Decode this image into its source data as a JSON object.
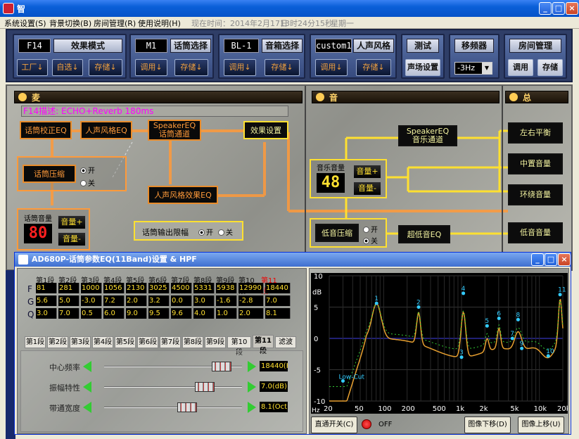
{
  "window": {
    "title": "智"
  },
  "menu": {
    "items": [
      "系统设置(S)",
      "背景切换(B)",
      "房间管理(R)",
      "使用说明(H)"
    ],
    "clock_label": "现在时间：2014年2月17日",
    "clock_time": "13时24分15秒",
    "weekday": "星期一"
  },
  "toolbar": {
    "effect": {
      "lcd": "F14",
      "title": "效果模式",
      "btn1": "工厂↓",
      "btn2": "自选↓",
      "btn3": "存储↓"
    },
    "mic": {
      "lcd": "M1",
      "title": "话筒选择",
      "btn1": "调用↓",
      "btn2": "存储↓"
    },
    "speaker": {
      "lcd": "BL-1",
      "title": "音箱选择",
      "btn1": "调用↓",
      "btn2": "存储↓"
    },
    "voice": {
      "lcd": "custom1",
      "title": "人声风格",
      "btn1": "调用↓",
      "btn2": "存储↓"
    },
    "test": {
      "title": "测试",
      "btn1": "声场设置"
    },
    "shift": {
      "title": "移频器",
      "value": "-3Hz"
    },
    "room": {
      "title": "房间管理",
      "btn1": "调用",
      "btn2": "存储"
    }
  },
  "main": {
    "sections": {
      "mic": "麦",
      "music": "音",
      "total": "总"
    },
    "description": "F14描述: ECHO+Reverb 180ms",
    "mic_blocks": {
      "mic_eq": "话筒校正EQ",
      "voice_eq": "人声风格EQ",
      "speaker_eq_line1": "SpeakerEQ",
      "speaker_eq_line2": "话筒通道",
      "effect_set": "效果设置",
      "compress": "话筒压缩",
      "voice_effect_eq": "人声风格效果EQ"
    },
    "compress_on": "开",
    "compress_off": "关",
    "mic_volume_label": "话筒音量",
    "mic_volume": "80",
    "mic_vol_up": "音量+",
    "mic_vol_down": "音量-",
    "mic_limit_label": "话筒输出限幅",
    "mic_limit_on": "开",
    "mic_limit_off": "关",
    "music_volume_label": "音乐音量",
    "music_volume": "48",
    "music_vol_up": "音量+",
    "music_vol_down": "音量-",
    "music_speaker_eq_line1": "SpeakerEQ",
    "music_speaker_eq_line2": "音乐通道",
    "bass_compress": "低音压缩",
    "bass_on": "开",
    "bass_off": "关",
    "sub_eq": "超低音EQ",
    "outputs": [
      "左右平衡",
      "中置音量",
      "环绕音量",
      "低音音量"
    ]
  },
  "dialog": {
    "title": "AD680P-话筒参数EQ(11Band)设置 & HPF",
    "band_headers": [
      "第1段",
      "第2段",
      "第3段",
      "第4段",
      "第5段",
      "第6段",
      "第7段",
      "第8段",
      "第9段",
      "第10段",
      "第11段"
    ],
    "row_labels": [
      "F",
      "G",
      "Q"
    ],
    "f_values": [
      "81",
      "281",
      "1000",
      "1056",
      "2130",
      "3025",
      "4500",
      "5331",
      "5938",
      "12990",
      "18440"
    ],
    "g_values": [
      "5.6",
      "5.0",
      "-3.0",
      "7.2",
      "2.0",
      "3.2",
      "0.0",
      "3.0",
      "-1.6",
      "-2.8",
      "7.0"
    ],
    "q_values": [
      "3.0",
      "7.0",
      "0.5",
      "6.0",
      "9.0",
      "9.5",
      "9.6",
      "4.0",
      "1.0",
      "2.0",
      "8.1"
    ],
    "tabs": [
      "第1段",
      "第2段",
      "第3段",
      "第4段",
      "第5段",
      "第6段",
      "第7段",
      "第8段",
      "第9段",
      "第10段",
      "第11段",
      "滤波"
    ],
    "active_tab": 10,
    "sliders": [
      {
        "name": "中心频率",
        "value": "18440(Hz)",
        "level": 0.85
      },
      {
        "name": "振幅特性",
        "value": "7.0(dB)",
        "level": 0.73
      },
      {
        "name": "带通宽度",
        "value": "8.1(Oct)",
        "level": 0.6
      }
    ],
    "graph": {
      "y_ticks": [
        "10",
        "5",
        "0",
        "-5",
        "-10"
      ],
      "y_unit": "dB",
      "x_ticks": [
        "20",
        "50",
        "100",
        "200",
        "500",
        "1k",
        "2k",
        "5k",
        "10k",
        "20k"
      ],
      "x_unit": "Hz",
      "lowcut_label": "Low-Cut",
      "point_labels": [
        "1",
        "2",
        "3",
        "4",
        "5",
        "6",
        "7",
        "8",
        "9",
        "10",
        "11"
      ]
    },
    "bypass_button": "直通开关(C)",
    "bypass_state": "OFF",
    "move_down": "图像下移(D)",
    "move_up": "图像上移(U)"
  },
  "colors": {
    "accent_orange": "#ff9a3a",
    "accent_yellow": "#ffe030",
    "title_blue": "#0A5FD8"
  }
}
